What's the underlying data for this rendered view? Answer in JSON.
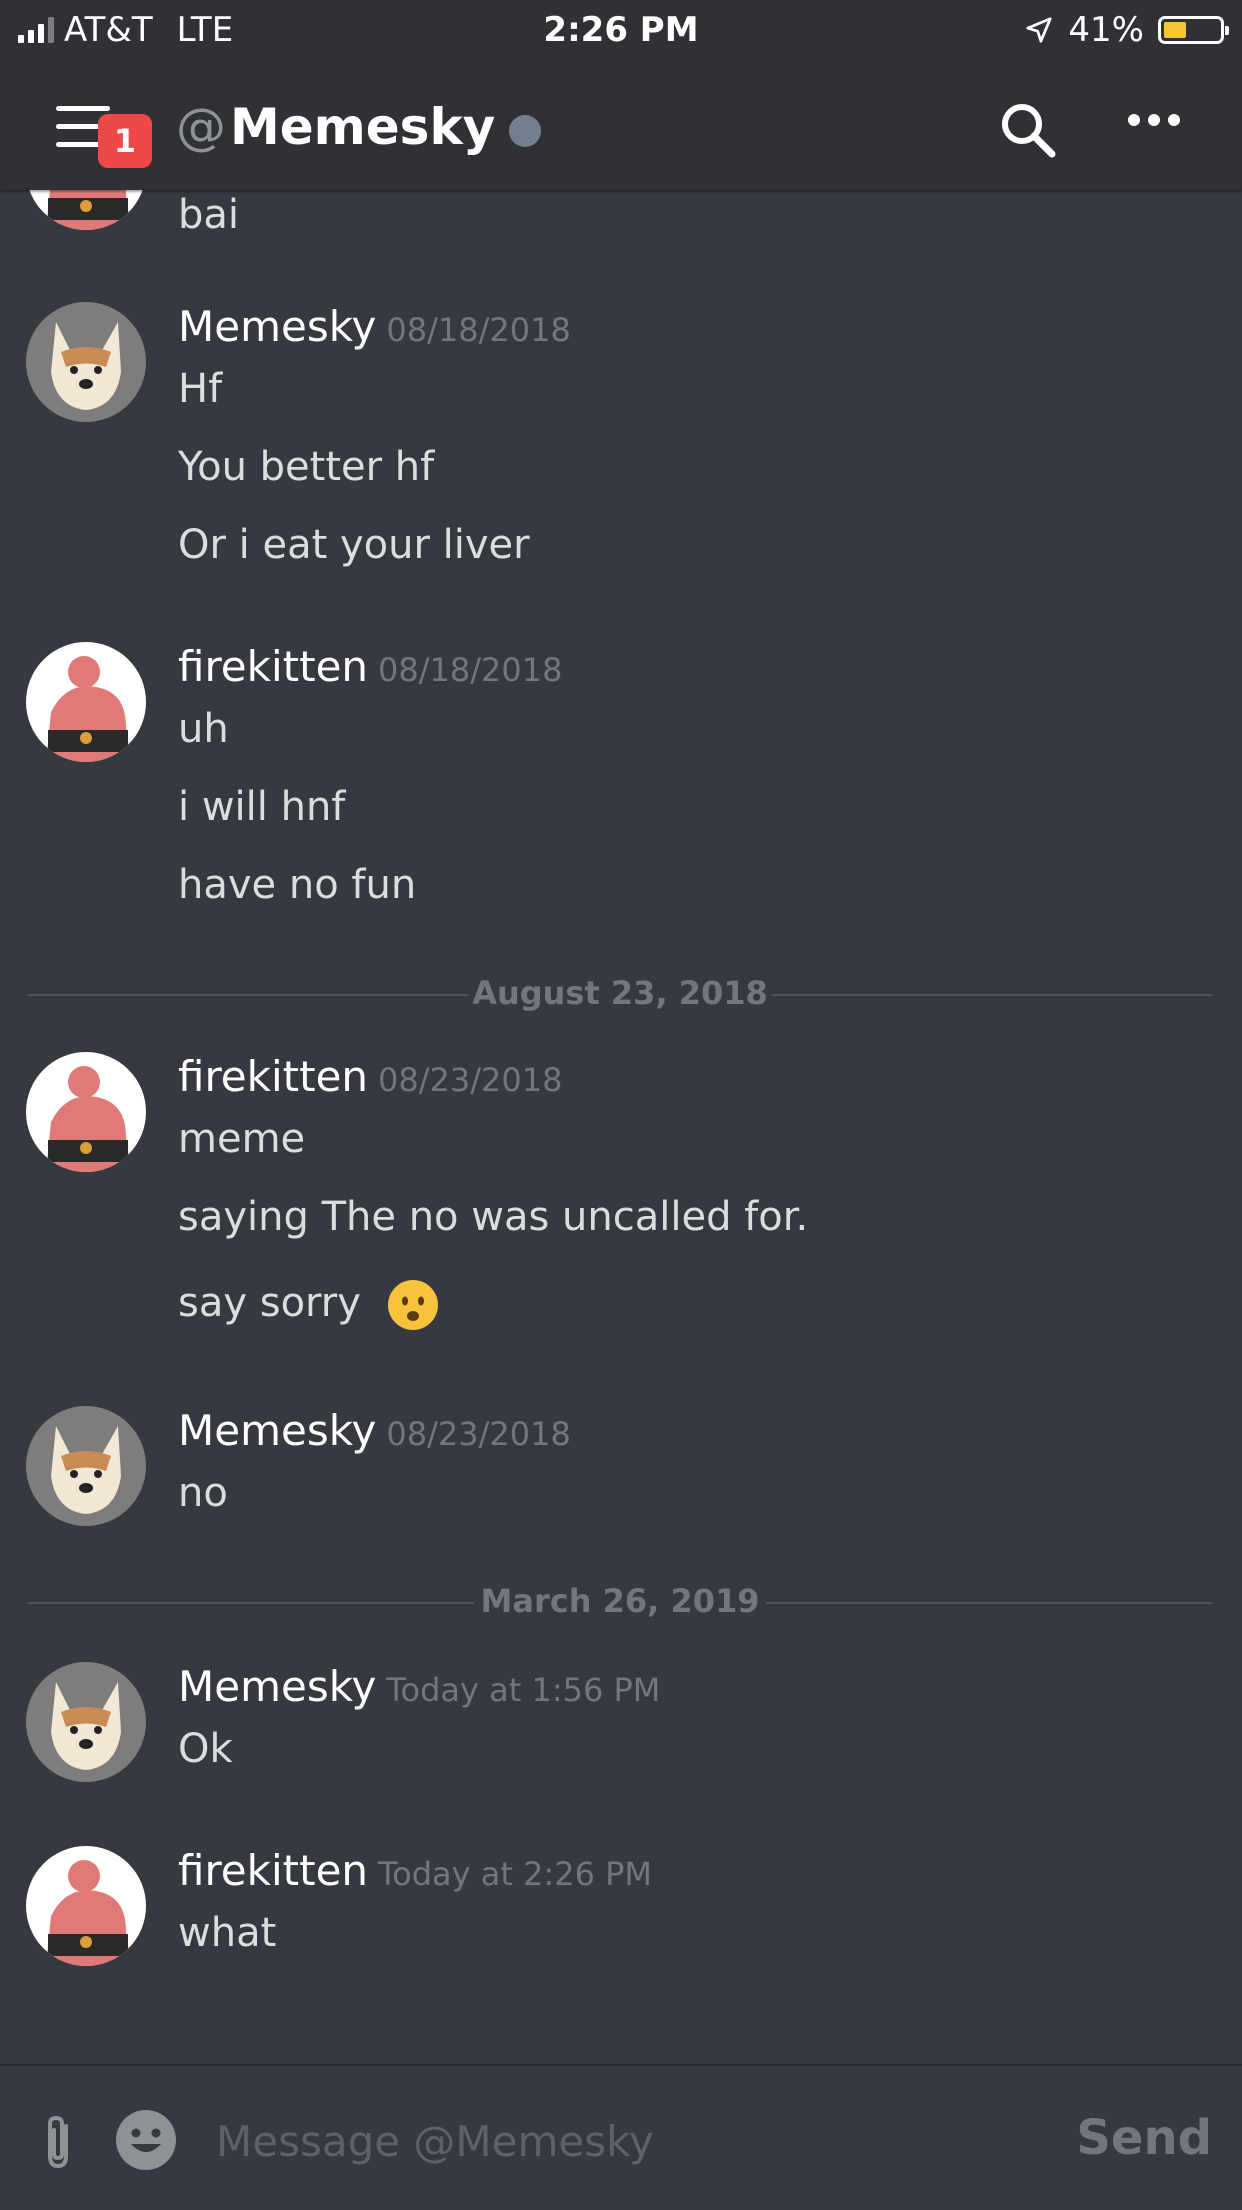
{
  "status_bar": {
    "carrier": "AT&T",
    "network": "LTE",
    "time": "2:26 PM",
    "battery": "41%",
    "battery_level": 0.41
  },
  "header": {
    "at": "@",
    "name": "Memesky",
    "unread_count": "1",
    "status": "offline"
  },
  "messages": [
    {
      "author": "",
      "time": "",
      "lines": [
        "bai"
      ]
    },
    {
      "author": "Memesky",
      "time": "08/18/2018",
      "lines": [
        "Hf",
        "You better hf",
        "Or i eat your liver"
      ]
    },
    {
      "author": "firekitten",
      "time": "08/18/2018",
      "lines": [
        "uh",
        "i will hnf",
        "have no fun"
      ]
    },
    {
      "divider": "August 23, 2018"
    },
    {
      "author": "firekitten",
      "time": "08/23/2018",
      "lines": [
        "meme",
        "saying The no was uncalled for.",
        "say sorry"
      ]
    },
    {
      "author": "Memesky",
      "time": "08/23/2018",
      "lines": [
        "no"
      ]
    },
    {
      "divider": "March 26, 2019"
    },
    {
      "author": "Memesky",
      "time": "Today at 1:56 PM",
      "lines": [
        "Ok"
      ]
    },
    {
      "author": "firekitten",
      "time": "Today at 2:26 PM",
      "lines": [
        "what"
      ]
    }
  ],
  "input": {
    "placeholder": "Message @Memesky",
    "send_label": "Send"
  },
  "colors": {
    "background": "#36393f",
    "header": "#2f3136",
    "badge": "#f04747",
    "status_offline": "#747f8d"
  },
  "icons": [
    "hamburger-menu-icon",
    "search-icon",
    "more-icon",
    "attach-icon",
    "emoji-icon",
    "location-arrow-icon",
    "battery-icon",
    "signal-icon"
  ]
}
